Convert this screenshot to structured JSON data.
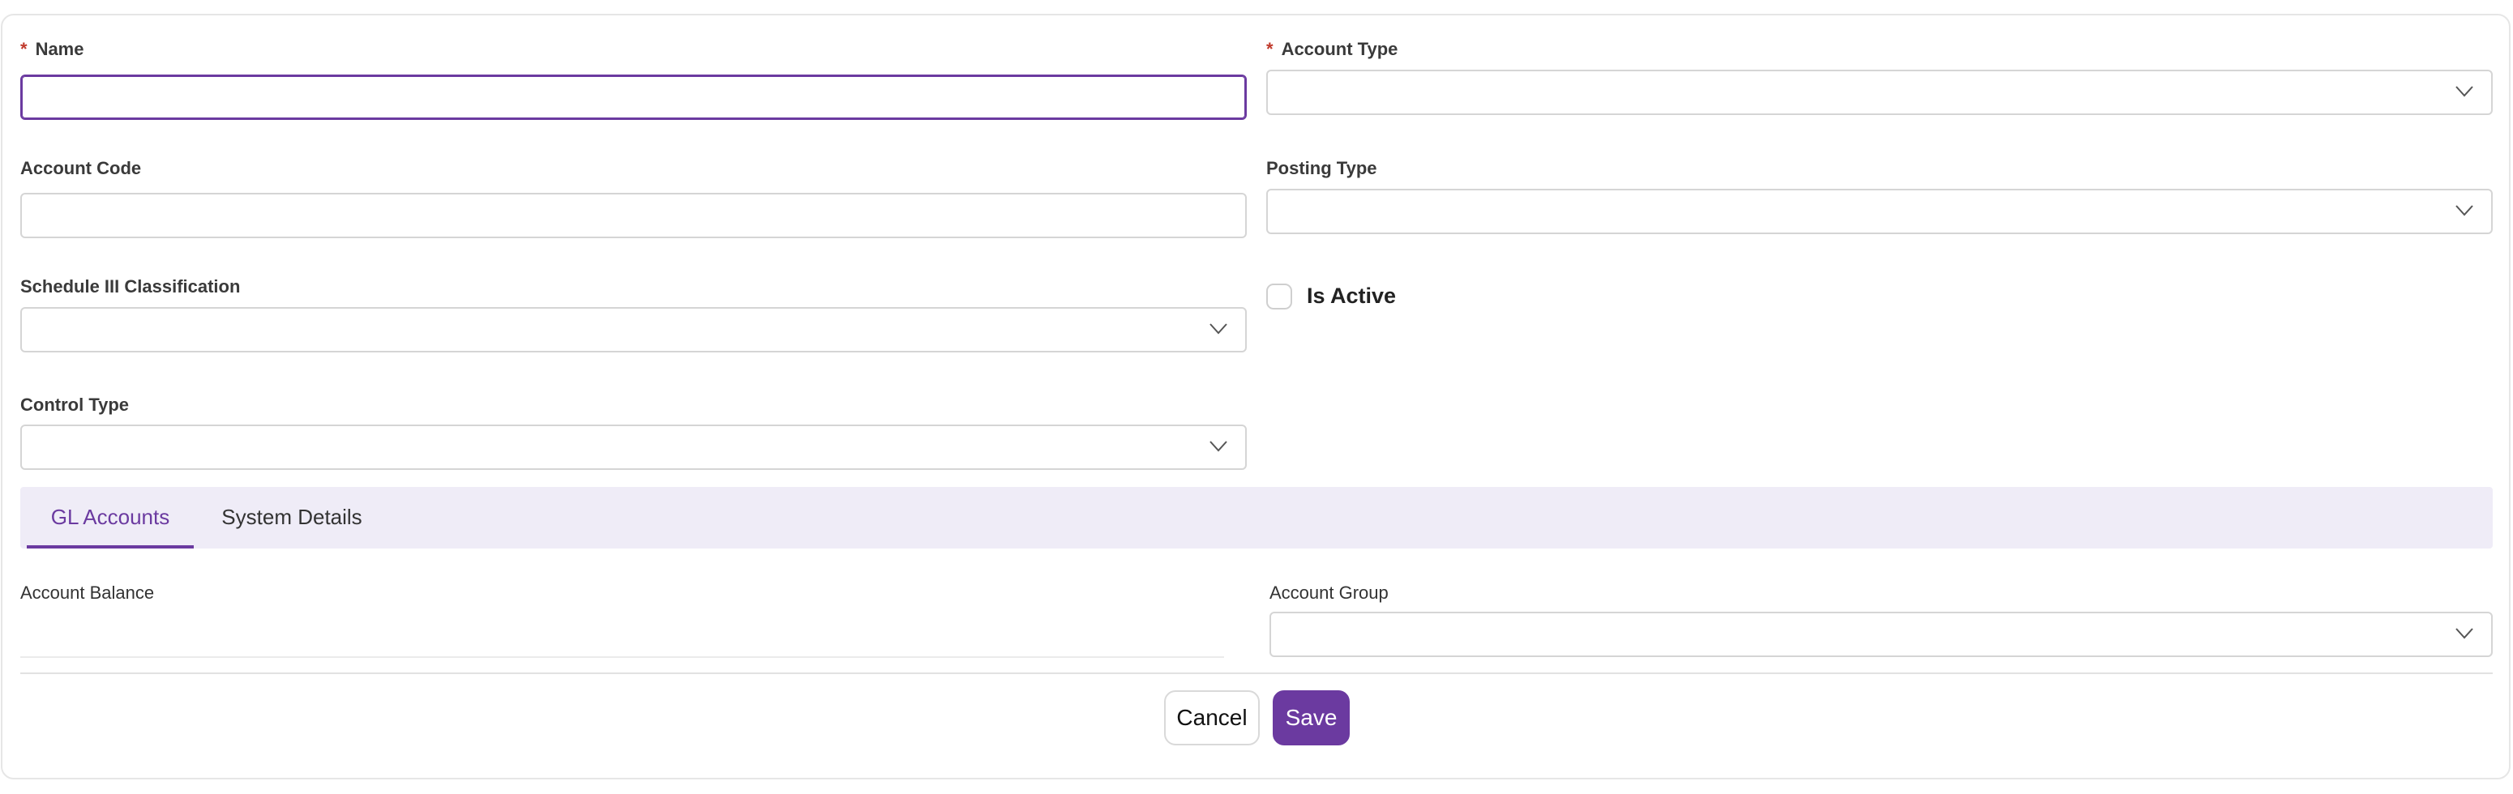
{
  "form": {
    "name_label": "Name",
    "name_required": "*",
    "name_value": "",
    "account_type_label": "Account Type",
    "account_type_required": "*",
    "account_type_value": "",
    "account_code_label": "Account Code",
    "account_code_value": "",
    "posting_type_label": "Posting Type",
    "posting_type_value": "",
    "schedule_label": "Schedule III Classification",
    "schedule_value": "",
    "is_active_label": "Is Active",
    "is_active_checked": false,
    "control_type_label": "Control Type",
    "control_type_value": ""
  },
  "tabs": [
    {
      "label": "GL Accounts",
      "active": true
    },
    {
      "label": "System Details",
      "active": false
    }
  ],
  "gl_accounts": {
    "account_balance_label": "Account Balance",
    "account_balance_value": "",
    "account_group_label": "Account Group",
    "account_group_value": ""
  },
  "actions": {
    "cancel_label": "Cancel",
    "save_label": "Save"
  },
  "colors": {
    "accent": "#6b3aa0",
    "required": "#c0392b",
    "tab_bar_bg": "#efecf7"
  },
  "icons": {
    "dropdown": "chevron-down-icon"
  }
}
